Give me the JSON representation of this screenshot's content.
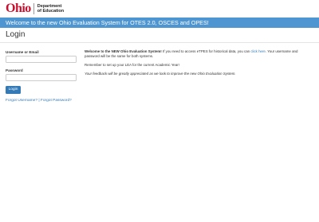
{
  "header": {
    "logo_text": "Ohio",
    "dept_line1": "Department",
    "dept_line2": "of Education"
  },
  "banner": {
    "text": "Welcome to the new Ohio Evaluation System for OTES 2.0, OSCES and OPES!"
  },
  "page": {
    "title": "Login"
  },
  "form": {
    "username_label": "Username or Email",
    "username_value": "",
    "password_label": "Password",
    "password_value": "",
    "login_label": "Login",
    "forgot_username": "Forgot Username?",
    "separator": " | ",
    "forgot_password": "Forgot Password?"
  },
  "info": {
    "welcome_strong": "Welcome to the NEW Ohio Evaluation System!",
    "welcome_rest_before_link": "  If you need to access eTPES for historical data, you can ",
    "welcome_link": "click here",
    "welcome_rest_after_link": ". Your username and password will be the same for both systems.",
    "reminder": "Remember to set up your LEA for the current Academic Year!",
    "feedback": "Your feedback will be greatly appreciated as we look to improve the new Ohio Evaluation System."
  },
  "colors": {
    "banner_bg": "#4d96d1",
    "brand_red": "#c8102e",
    "link_blue": "#337ab7",
    "button_bg": "#337ab7"
  }
}
